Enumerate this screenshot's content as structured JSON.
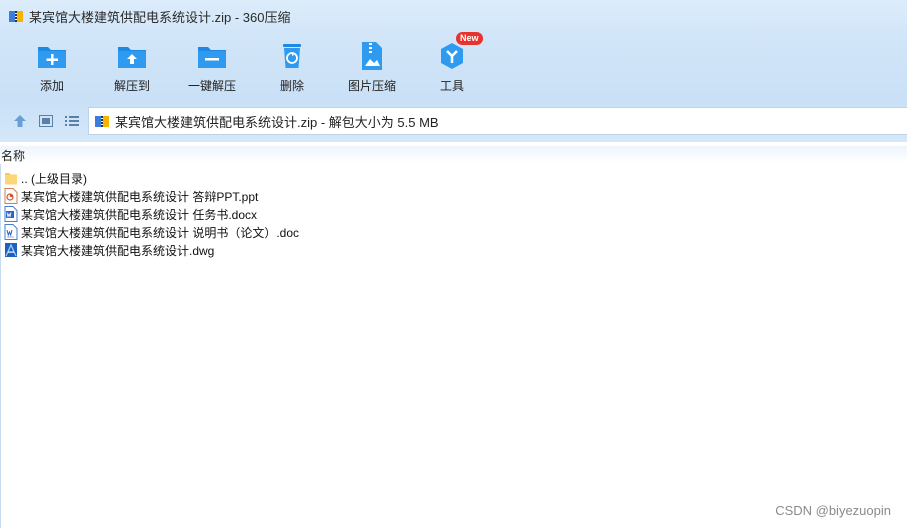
{
  "window": {
    "title": "某宾馆大楼建筑供配电系统设计.zip - 360压缩"
  },
  "toolbar": {
    "items": [
      {
        "label": "添加",
        "icon": "add-file-icon"
      },
      {
        "label": "解压到",
        "icon": "extract-to-icon"
      },
      {
        "label": "一键解压",
        "icon": "one-click-extract-icon"
      },
      {
        "label": "删除",
        "icon": "delete-icon"
      },
      {
        "label": "图片压缩",
        "icon": "image-compress-icon"
      },
      {
        "label": "工具",
        "icon": "tools-icon",
        "badge": "New"
      }
    ]
  },
  "addressbar": {
    "path": "某宾馆大楼建筑供配电系统设计.zip - 解包大小为 5.5 MB"
  },
  "filelist": {
    "column_name": "名称",
    "rows": [
      {
        "name": ".. (上级目录)",
        "icon": "folder-up-icon"
      },
      {
        "name": "某宾馆大楼建筑供配电系统设计 答辩PPT.ppt",
        "icon": "ppt-file-icon"
      },
      {
        "name": "某宾馆大楼建筑供配电系统设计 任务书.docx",
        "icon": "docx-file-icon"
      },
      {
        "name": "某宾馆大楼建筑供配电系统设计 说明书（论文）.doc",
        "icon": "doc-file-icon"
      },
      {
        "name": "某宾馆大楼建筑供配电系统设计.dwg",
        "icon": "dwg-file-icon"
      }
    ]
  },
  "watermark": "CSDN @biyezuopin",
  "colors": {
    "accent": "#1e88e5",
    "titlebar_bg": "#dcecfb",
    "toolbar_bg": "#c9e0f6"
  }
}
